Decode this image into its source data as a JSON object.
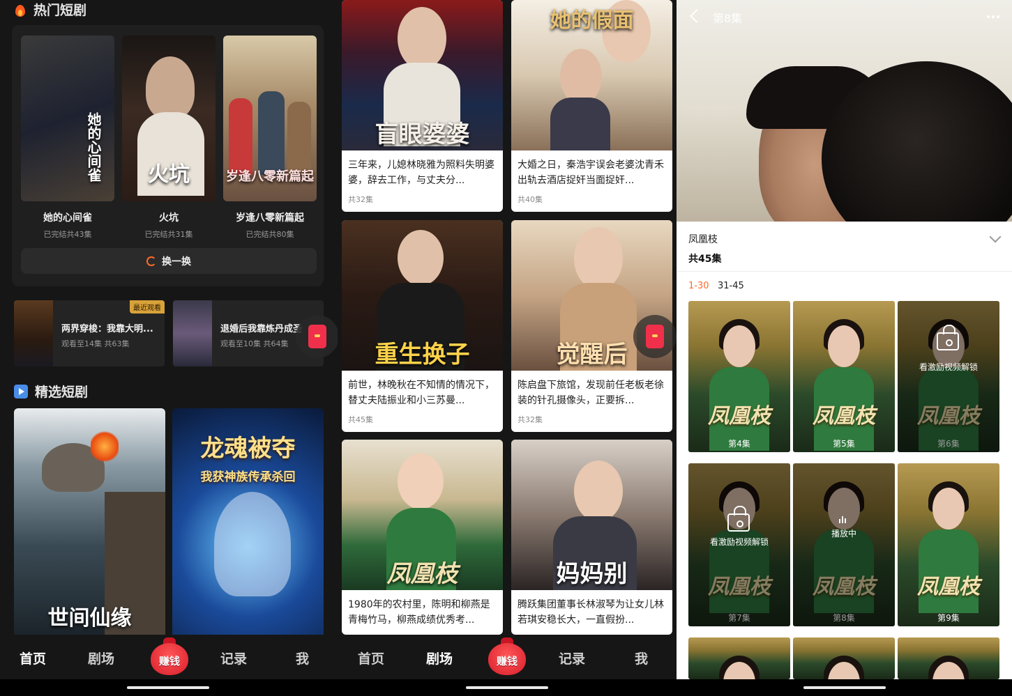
{
  "s1": {
    "hot_title": "热门短剧",
    "hot_items": [
      {
        "poster_title": "她的心间雀",
        "name": "她的心间雀",
        "sub": "已完结共43集"
      },
      {
        "poster_title": "火坑",
        "name": "火坑",
        "sub": "已完结共31集"
      },
      {
        "poster_title": "岁逢八零新篇起",
        "name": "岁逢八零新篇起",
        "sub": "已完结共80集"
      }
    ],
    "swap_label": "换一换",
    "recent": [
      {
        "title": "两界穿梭：我靠大明...",
        "sub": "观看至14集 共63集",
        "badge": "最近观看"
      },
      {
        "title": "退婚后我靠炼丹成圣",
        "sub": "观看至10集 共64集"
      }
    ],
    "sel_title": "精选短剧",
    "sel_items": [
      {
        "poster_title": "世间仙缘"
      },
      {
        "poster_title": "龙魂被夺",
        "poster_sub": "我获神族传承杀回"
      }
    ]
  },
  "s2": {
    "cards": [
      {
        "poster_title": "盲眼婆婆",
        "desc": "三年来，儿媳林晓雅为照料失明婆婆，辞去工作，与丈夫分...",
        "eps": "共32集"
      },
      {
        "poster_title": "她的假面",
        "desc": "大婚之日，秦浩宇误会老婆沈青禾出轨去酒店捉奸当面捉奸...",
        "eps": "共40集"
      },
      {
        "poster_title": "重生换子",
        "desc": "前世，林晚秋在不知情的情况下，替丈夫陆振业和小三苏曼...",
        "eps": "共45集"
      },
      {
        "poster_title": "觉醒后",
        "desc": "陈启盘下旅馆，发现前任老板老徐装的针孔摄像头，正要拆...",
        "eps": "共32集"
      },
      {
        "poster_title": "凤凰枝",
        "desc": "1980年的农村里，陈明和柳燕是青梅竹马，柳燕成绩优秀考...",
        "eps": ""
      },
      {
        "poster_title": "妈妈别",
        "desc": "腾跃集团董事长林淑琴为让女儿林若琪安稳长大，一直假扮...",
        "eps": ""
      }
    ]
  },
  "nav": {
    "home": "首页",
    "theater": "剧场",
    "earn": "赚钱",
    "record": "记录",
    "me": "我"
  },
  "s3": {
    "episode_title": "第8集",
    "drama_name": "凤凰枝",
    "drama_count": "共45集",
    "range_1": "1-30",
    "range_2": "31-45",
    "tile_word": "凤凰枝",
    "lock_text": "看激励视频解锁",
    "playing_text": "播放中",
    "tiles": [
      {
        "ep": "第4集",
        "state": "normal"
      },
      {
        "ep": "第5集",
        "state": "normal"
      },
      {
        "ep": "第6集",
        "state": "locked"
      },
      {
        "ep": "第7集",
        "state": "locked"
      },
      {
        "ep": "第8集",
        "state": "playing"
      },
      {
        "ep": "第9集",
        "state": "normal"
      }
    ]
  },
  "colors": {
    "accent": "#ff6a2a",
    "red": "#e8283a",
    "card_bg": "#1f1f1f"
  }
}
